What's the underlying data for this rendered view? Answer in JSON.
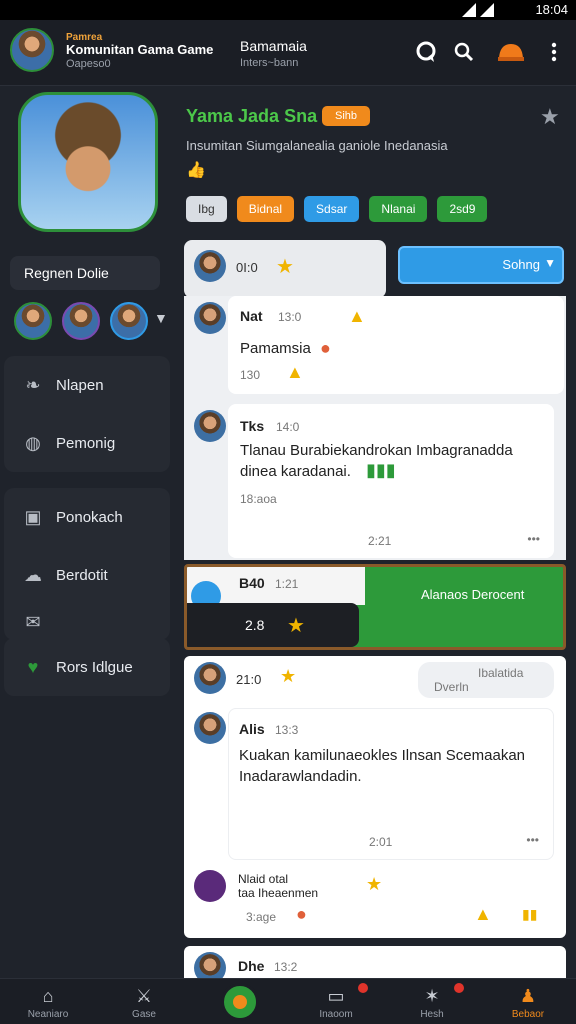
{
  "status": {
    "time": "18:04"
  },
  "topbar": {
    "tiny_label": "Pamrea",
    "title": "Komunitan Gama Game",
    "subtitle": "Oapeso0",
    "center_title": "Bamamaia",
    "center_sub": "Inters~bann"
  },
  "profile": {
    "name": "Yama Jada Sna",
    "badge": "Sihb",
    "description": "Insumitan Siumgalanealia ganiole Inedanasia",
    "tags": [
      {
        "label": "Ibg",
        "color": "#d9dde3",
        "text_color": "#333333"
      },
      {
        "label": "Bidnal",
        "color": "#f08a1c",
        "text_color": "#ffffff"
      },
      {
        "label": "Sdsar",
        "color": "#2f9be6",
        "text_color": "#ffffff"
      },
      {
        "label": "Nlanai",
        "color": "#2d9a3a",
        "text_color": "#ffffff"
      },
      {
        "label": "2sd9",
        "color": "#2d9a3a",
        "text_color": "#ffffff"
      }
    ]
  },
  "sidebar": {
    "user": "Regnen Dolie",
    "group1": [
      {
        "label": "Nlapen",
        "icon": "leaf-icon"
      },
      {
        "label": "Pemonig",
        "icon": "helmet-icon"
      }
    ],
    "group2": [
      {
        "label": "Ponokach",
        "icon": "card-icon"
      },
      {
        "label": "Berdotit",
        "icon": "chat-icon"
      },
      {
        "label": "",
        "icon": "mail-icon"
      }
    ],
    "group3": [
      {
        "label": "Rors Idlgue",
        "icon": "shield-icon"
      }
    ]
  },
  "feed": {
    "header": {
      "count": "0I:0",
      "button": "Sohng"
    },
    "msg1": {
      "name": "Nat",
      "time": "13:0",
      "text": "Pamamsia",
      "footer": "130"
    },
    "msg2": {
      "name": "Tks",
      "time": "14:0",
      "text1": "Tlanau Burabiekandrokan Imbagranadda",
      "text2": "dinea karadanai.",
      "tag": "18:aoa",
      "time2": "2:21"
    },
    "banner": {
      "name": "B40",
      "time": "1:21",
      "text": "Alanaos Derocent",
      "counter": "2.8"
    },
    "msg3": {
      "count": "21:0",
      "bubble1": "Ibalatida",
      "bubble2": "Dverln",
      "name": "Alis",
      "time": "13:3",
      "text1": "Kuakan kamilunaeokles Ilnsan Scemaakan",
      "text2": "Inadarawlandadin.",
      "time2": "2:01"
    },
    "msg4": {
      "name1": "Nlaid otal",
      "name2": "taa Iheaenmen",
      "meta": "3:age"
    },
    "msg5": {
      "name": "Dhe",
      "time": "13:2"
    }
  },
  "navbar": [
    {
      "label": "Neaniaro",
      "icon": "home-icon"
    },
    {
      "label": "Gase",
      "icon": "sword-icon"
    },
    {
      "label": "",
      "icon": "center-action-icon"
    },
    {
      "label": "Inaoom",
      "icon": "notification-icon"
    },
    {
      "label": "Hesh",
      "icon": "battle-icon"
    },
    {
      "label": "Bebaor",
      "icon": "profile-icon"
    }
  ]
}
